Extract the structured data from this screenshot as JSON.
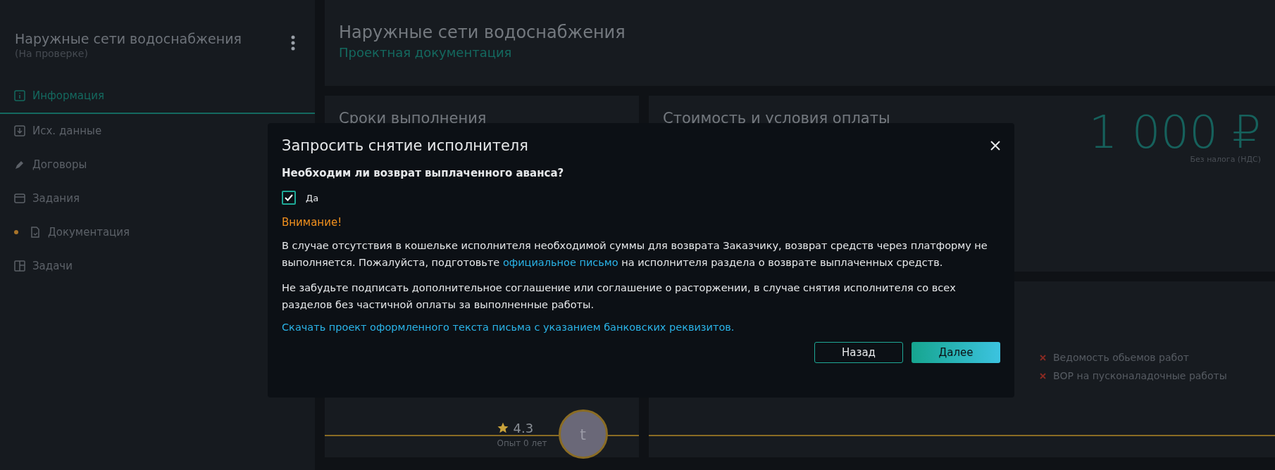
{
  "sidebar": {
    "title": "Наружные сети водоснабжения",
    "status": "(На проверке)",
    "items": [
      {
        "label": "Информация",
        "selected": true
      },
      {
        "label": "Исх. данные",
        "selected": false
      },
      {
        "label": "Договоры",
        "selected": false
      },
      {
        "label": "Задания",
        "selected": false
      },
      {
        "label": "Документация",
        "selected": false,
        "color": "#a8742a"
      },
      {
        "label": "Задачи",
        "selected": false
      }
    ]
  },
  "header": {
    "title": "Наружные сети водоснабжения",
    "subtitle": "Проектная документация"
  },
  "deadlines_card": {
    "title": "Сроки выполнения"
  },
  "cost_card": {
    "title": "Стоимость и условия оплаты",
    "amount": "1 000 ₽",
    "tax_note": "Без налога (НДС)"
  },
  "executor_card": {
    "rating": "4.3",
    "experience": "Опыт 0 лет",
    "avatar_letter": "t"
  },
  "documents_card": {
    "items": [
      {
        "label": "Ведомость обьемов работ",
        "done": false
      },
      {
        "label": "ВОР на пусконаладочные работы",
        "done": false
      }
    ]
  },
  "dialog": {
    "title": "Запросить снятие исполнителя",
    "question": "Необходим ли возврат выплаченного аванса?",
    "checkbox": {
      "label": "Да",
      "checked": true
    },
    "warning_title": "Внимание!",
    "paragraph_1": {
      "before": "В случае отсутствия в кошельке исполнителя необходимой суммы для возврата Заказчику, возврат средств через платформу не выполняется. Пожалуйста, подготовьте ",
      "link": "официальное письмо",
      "after": " на исполнителя раздела о возврате выплаченных средств."
    },
    "paragraph_2": "Не забудьте подписать дополнительное соглашение или соглашение о расторжении, в случае снятия исполнителя со всех разделов без частичной оплаты за выполненные работы.",
    "download_link": "Скачать проект оформленного текста письма с указанием банковских реквизитов.",
    "buttons": [
      {
        "label": "Назад",
        "kind": "secondary"
      },
      {
        "label": "Далее",
        "kind": "primary"
      }
    ]
  }
}
